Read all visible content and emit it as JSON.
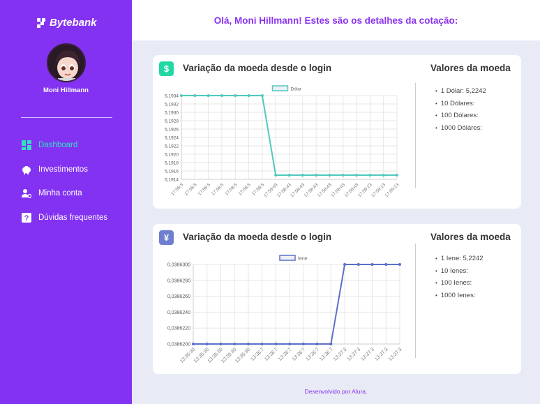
{
  "sidebar": {
    "logo": "Bytebank",
    "user_name": "Moni Hillmann",
    "items": [
      {
        "label": "Dashboard",
        "icon": "dashboard-icon",
        "active": true
      },
      {
        "label": "Investimentos",
        "icon": "piggy-bank-icon",
        "active": false
      },
      {
        "label": "Minha conta",
        "icon": "user-settings-icon",
        "active": false
      },
      {
        "label": "Dúvidas frequentes",
        "icon": "question-icon",
        "active": false
      }
    ]
  },
  "header": {
    "title": "Olá, Moni Hillmann! Estes são os detalhes da cotação:"
  },
  "cards": [
    {
      "icon": "$",
      "title": "Variação da moeda desde o login",
      "values_title": "Valores da moeda",
      "values": [
        "1 Dólar: 5,2242",
        "10 Dólares:",
        "100 Dólares:",
        "1000 Dólares:"
      ]
    },
    {
      "icon": "¥",
      "title": "Variação da moeda desde o login",
      "values_title": "Valores da moeda",
      "values": [
        "1 Iene: 5,2242",
        "10 Ienes:",
        "100 Ienes:",
        "1000 Ienes:"
      ]
    }
  ],
  "chart_data": [
    {
      "type": "line",
      "legend": "Dólar",
      "color": "#4fc9bd",
      "x": [
        "17:58:5",
        "17:58:5",
        "17:58:5",
        "17:58:5",
        "17:58:5",
        "17:58:5",
        "17:58:5",
        "17:58:43",
        "17:58:43",
        "17:58:43",
        "17:58:43",
        "17:58:43",
        "17:58:43",
        "17:58:43",
        "17:59:13",
        "17:59:13",
        "17:59:13"
      ],
      "values": [
        5.1934,
        5.1934,
        5.1934,
        5.1934,
        5.1934,
        5.1934,
        5.1934,
        5.1915,
        5.1915,
        5.1915,
        5.1915,
        5.1915,
        5.1915,
        5.1915,
        5.1915,
        5.1915,
        5.1915
      ],
      "y_ticks": [
        "5,1914",
        "5,1916",
        "5,1918",
        "5,1920",
        "5,1922",
        "5,1924",
        "5,1926",
        "5,1928",
        "5,1930",
        "5,1932",
        "5,1934"
      ],
      "ylim": [
        5.1914,
        5.1934
      ],
      "grid": true,
      "legend_position": "top"
    },
    {
      "type": "line",
      "legend": "Iene",
      "color": "#5b6fc9",
      "x": [
        "13:35:30",
        "13:35:30",
        "13:35:30",
        "13:35:30",
        "13:35:30",
        "13:36:7",
        "13:36:7",
        "13:36:7",
        "13:36:7",
        "13:36:7",
        "13:36:7",
        "13:37:3",
        "13:37:3",
        "13:37:3",
        "13:37:3",
        "13:37:3"
      ],
      "values": [
        0.03862,
        0.03862,
        0.03862,
        0.03862,
        0.03862,
        0.03862,
        0.03862,
        0.03862,
        0.03862,
        0.03862,
        0.03862,
        0.03863,
        0.03863,
        0.03863,
        0.03863,
        0.03863
      ],
      "y_ticks": [
        "0,0386200",
        "0,0386220",
        "0,0386240",
        "0,0386260",
        "0,0386280",
        "0,0386300"
      ],
      "ylim": [
        0.03862,
        0.03863
      ],
      "grid": true,
      "legend_position": "top"
    }
  ],
  "footer": "Desenvolvido por Alura."
}
